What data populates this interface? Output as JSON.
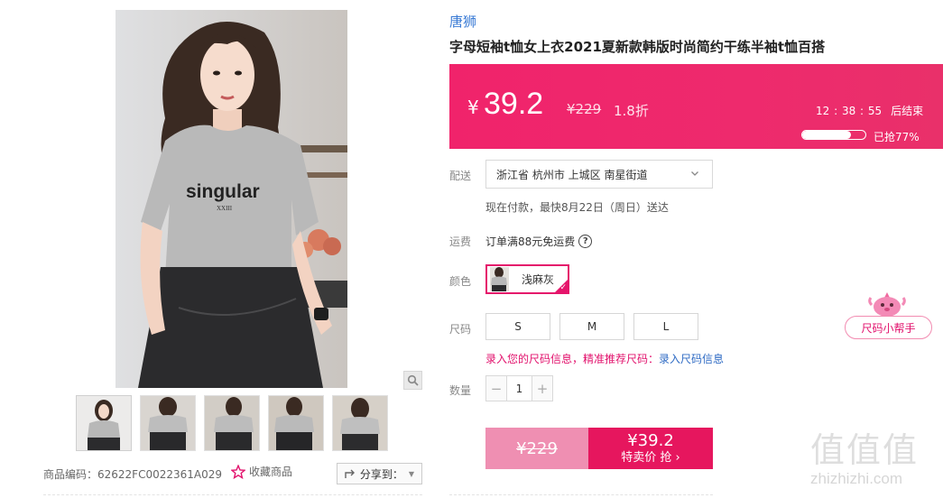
{
  "brand": "唐狮",
  "title": "字母短袖t恤女上衣2021夏新款韩版时尚简约干练半袖t恤百搭",
  "gallery": {
    "shirt_print": "singular",
    "thumb_count": 5,
    "zoom_icon": "magnifier-icon"
  },
  "price": {
    "currency": "¥",
    "current": "39.2",
    "original": "¥229",
    "discount": "1.8折",
    "countdown": "12 : 38 : 55",
    "countdown_suffix": "后结束",
    "sold_percent": 77,
    "sold_text": "已抢77%"
  },
  "delivery": {
    "label": "配送",
    "address": "浙江省 杭州市 上城区 南星街道",
    "note": "现在付款，最快8月22日（周日）送达"
  },
  "shipping": {
    "label": "运费",
    "text": "订单满88元免运费",
    "help": "?"
  },
  "color": {
    "label": "颜色",
    "selected": "浅麻灰"
  },
  "size": {
    "label": "尺码",
    "options": [
      "S",
      "M",
      "L"
    ],
    "tip_prefix": "录入您的尺码信息，精准推荐尺码：",
    "tip_link": "录入尺码信息"
  },
  "quantity": {
    "label": "数量",
    "value": "1",
    "minus": "−",
    "plus": "+"
  },
  "buy": {
    "original": "¥229",
    "price": "¥39.2",
    "label": "特卖价 抢 ›"
  },
  "size_helper": "尺码小帮手",
  "product_code": "商品编码：62622FC0022361A029",
  "favorite": "收藏商品",
  "share": "分享到：",
  "watermark": {
    "text": "值值值",
    "url": "zhizhizhi.com"
  },
  "colors": {
    "accent": "#e6165e",
    "brand_link": "#3a7bd5"
  }
}
